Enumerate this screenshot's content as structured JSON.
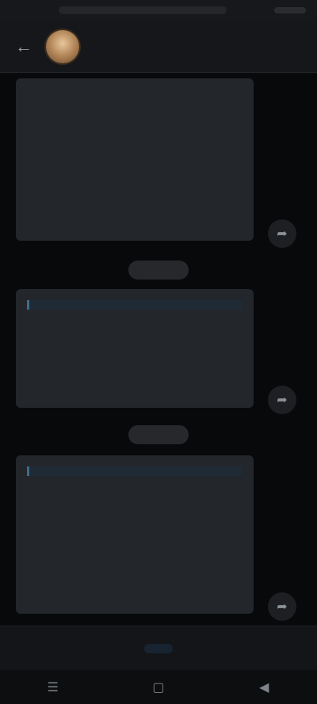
{
  "status_bar": {
    "time": "",
    "battery": ""
  },
  "header": {
    "title": "",
    "subtitle": ""
  },
  "messages": [
    {
      "text": "",
      "time": ""
    },
    {
      "quote": "",
      "text": "",
      "time": ""
    },
    {
      "quote": "",
      "text": "",
      "time": ""
    }
  ],
  "date_chips": [
    "",
    ""
  ],
  "bottom_bar": {
    "action_label": ""
  },
  "icons": {
    "back": "back-arrow-icon",
    "share": "share-icon",
    "nav": [
      "menu-icon",
      "home-icon",
      "back-icon"
    ]
  },
  "colors": {
    "accent": "#4d93c9",
    "bubble": "#23262a",
    "background": "#08090b"
  }
}
